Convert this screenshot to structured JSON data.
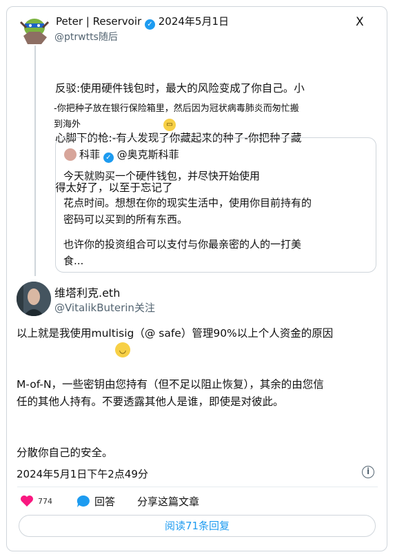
{
  "top_tweet": {
    "author_name": "Peter | Reservoir",
    "date": "2024年5月1日",
    "handle": "@ptrwtts随后",
    "close_label": "X",
    "body_line1": "反驳:使用硬件钱包时，最大的风险变成了你自己。小",
    "body_line2": "心脚下的枪:-有人发现了你藏起来的种子-你把种子藏",
    "body_line3": "得太好了，以至于忘记了",
    "body2_line1": "-你把种子放在银行保险箱里，然后因为冠状病毒肺炎而匆忙搬",
    "body2_line2": "到海外"
  },
  "quoted_tweet": {
    "author_name": "科菲",
    "handle": "@奥克斯科菲",
    "line1": "今天就购买一个硬件钱包，并尽快开始使用",
    "line2": "花点时间。想想在你的现实生活中，使用你目前持有的",
    "line3": "密码可以买到的所有东西。",
    "line4": "也许你的投资组合可以支付与你最亲密的人的一打美",
    "line5": "食..."
  },
  "main_tweet": {
    "author_name": "维塔利克.eth",
    "handle": "@VitalikButerin关注",
    "para1": "以上就是我使用multisig（@ safe）管理90%以上个人资金的原因",
    "para2_line1": "M-of-N，一些密钥由您持有（但不足以阻止恢复），其余的由您信",
    "para2_line2": "任的其他人持有。不要透露其他人是谁，即使是对彼此。",
    "para3": "分散你自己的安全。",
    "timestamp": "2024年5月1日下午2点49分"
  },
  "actions": {
    "like_count": "774",
    "reply_label": "回答",
    "share_label": "分享这篇文章",
    "read_replies_label": "阅读71条回复"
  },
  "colors": {
    "accent": "#1d9bf0",
    "like": "#f91880",
    "border": "#cfd5db"
  }
}
